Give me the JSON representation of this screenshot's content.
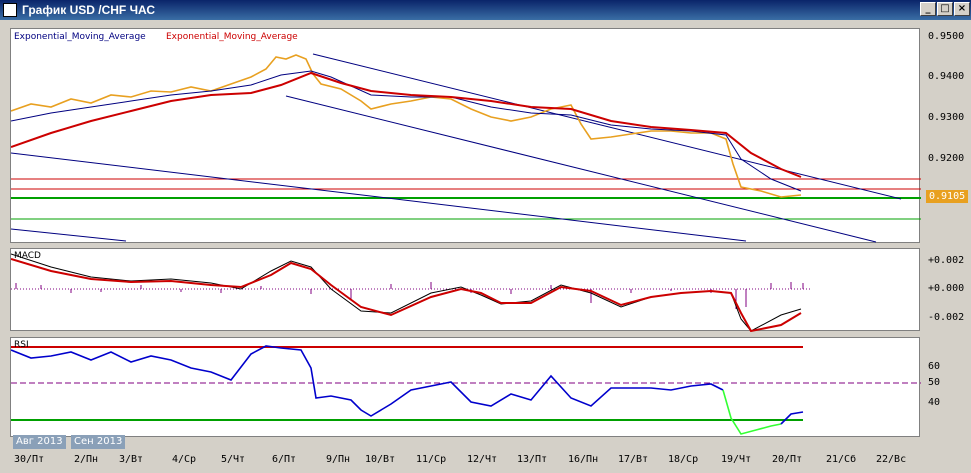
{
  "window": {
    "title": "График USD /CHF  ЧАС"
  },
  "price_panel": {
    "legend_1": "Exponential_Moving_Average",
    "legend_2": "Exponential_Moving_Average",
    "y_ticks": [
      "0.9500",
      "0.9400",
      "0.9300",
      "0.9200"
    ],
    "current_price": "0.9105"
  },
  "macd_panel": {
    "label": "MACD",
    "y_ticks": [
      "+0.002",
      "+0.000",
      "-0.002"
    ]
  },
  "rsi_panel": {
    "label": "RSI",
    "y_ticks": [
      "60",
      "50",
      "40"
    ]
  },
  "x_ticks": [
    "30/Пт",
    "2/Пн",
    "3/Вт",
    "4/Ср",
    "5/Чт",
    "6/Пт",
    "9/Пн",
    "10/Вт",
    "11/Ср",
    "12/Чт",
    "13/Пт",
    "16/Пн",
    "17/Вт",
    "18/Ср",
    "19/Чт",
    "20/Пт",
    "21/Сб",
    "22/Вс"
  ],
  "tabs": [
    "Авг 2013",
    "Сен 2013"
  ],
  "colors": {
    "price": "#e8a020",
    "ema_slow": "#cc0000",
    "ema_fast": "#000080",
    "trend": "#000080",
    "support": "#00a000",
    "rsi_line": "#0000cc",
    "rsi_low": "#33ff33",
    "macd_hist": "#800080"
  }
}
